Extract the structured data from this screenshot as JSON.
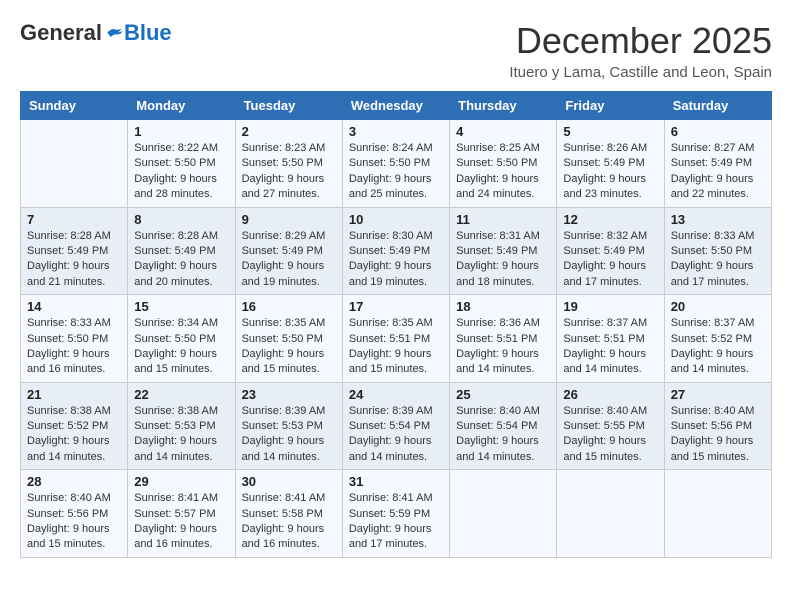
{
  "logo": {
    "general": "General",
    "blue": "Blue"
  },
  "header": {
    "month": "December 2025",
    "location": "Ituero y Lama, Castille and Leon, Spain"
  },
  "columns": [
    "Sunday",
    "Monday",
    "Tuesday",
    "Wednesday",
    "Thursday",
    "Friday",
    "Saturday"
  ],
  "weeks": [
    [
      {
        "day": "",
        "info": ""
      },
      {
        "day": "1",
        "info": "Sunrise: 8:22 AM\nSunset: 5:50 PM\nDaylight: 9 hours and 28 minutes."
      },
      {
        "day": "2",
        "info": "Sunrise: 8:23 AM\nSunset: 5:50 PM\nDaylight: 9 hours and 27 minutes."
      },
      {
        "day": "3",
        "info": "Sunrise: 8:24 AM\nSunset: 5:50 PM\nDaylight: 9 hours and 25 minutes."
      },
      {
        "day": "4",
        "info": "Sunrise: 8:25 AM\nSunset: 5:50 PM\nDaylight: 9 hours and 24 minutes."
      },
      {
        "day": "5",
        "info": "Sunrise: 8:26 AM\nSunset: 5:49 PM\nDaylight: 9 hours and 23 minutes."
      },
      {
        "day": "6",
        "info": "Sunrise: 8:27 AM\nSunset: 5:49 PM\nDaylight: 9 hours and 22 minutes."
      }
    ],
    [
      {
        "day": "7",
        "info": "Sunrise: 8:28 AM\nSunset: 5:49 PM\nDaylight: 9 hours and 21 minutes."
      },
      {
        "day": "8",
        "info": "Sunrise: 8:28 AM\nSunset: 5:49 PM\nDaylight: 9 hours and 20 minutes."
      },
      {
        "day": "9",
        "info": "Sunrise: 8:29 AM\nSunset: 5:49 PM\nDaylight: 9 hours and 19 minutes."
      },
      {
        "day": "10",
        "info": "Sunrise: 8:30 AM\nSunset: 5:49 PM\nDaylight: 9 hours and 19 minutes."
      },
      {
        "day": "11",
        "info": "Sunrise: 8:31 AM\nSunset: 5:49 PM\nDaylight: 9 hours and 18 minutes."
      },
      {
        "day": "12",
        "info": "Sunrise: 8:32 AM\nSunset: 5:49 PM\nDaylight: 9 hours and 17 minutes."
      },
      {
        "day": "13",
        "info": "Sunrise: 8:33 AM\nSunset: 5:50 PM\nDaylight: 9 hours and 17 minutes."
      }
    ],
    [
      {
        "day": "14",
        "info": "Sunrise: 8:33 AM\nSunset: 5:50 PM\nDaylight: 9 hours and 16 minutes."
      },
      {
        "day": "15",
        "info": "Sunrise: 8:34 AM\nSunset: 5:50 PM\nDaylight: 9 hours and 15 minutes."
      },
      {
        "day": "16",
        "info": "Sunrise: 8:35 AM\nSunset: 5:50 PM\nDaylight: 9 hours and 15 minutes."
      },
      {
        "day": "17",
        "info": "Sunrise: 8:35 AM\nSunset: 5:51 PM\nDaylight: 9 hours and 15 minutes."
      },
      {
        "day": "18",
        "info": "Sunrise: 8:36 AM\nSunset: 5:51 PM\nDaylight: 9 hours and 14 minutes."
      },
      {
        "day": "19",
        "info": "Sunrise: 8:37 AM\nSunset: 5:51 PM\nDaylight: 9 hours and 14 minutes."
      },
      {
        "day": "20",
        "info": "Sunrise: 8:37 AM\nSunset: 5:52 PM\nDaylight: 9 hours and 14 minutes."
      }
    ],
    [
      {
        "day": "21",
        "info": "Sunrise: 8:38 AM\nSunset: 5:52 PM\nDaylight: 9 hours and 14 minutes."
      },
      {
        "day": "22",
        "info": "Sunrise: 8:38 AM\nSunset: 5:53 PM\nDaylight: 9 hours and 14 minutes."
      },
      {
        "day": "23",
        "info": "Sunrise: 8:39 AM\nSunset: 5:53 PM\nDaylight: 9 hours and 14 minutes."
      },
      {
        "day": "24",
        "info": "Sunrise: 8:39 AM\nSunset: 5:54 PM\nDaylight: 9 hours and 14 minutes."
      },
      {
        "day": "25",
        "info": "Sunrise: 8:40 AM\nSunset: 5:54 PM\nDaylight: 9 hours and 14 minutes."
      },
      {
        "day": "26",
        "info": "Sunrise: 8:40 AM\nSunset: 5:55 PM\nDaylight: 9 hours and 15 minutes."
      },
      {
        "day": "27",
        "info": "Sunrise: 8:40 AM\nSunset: 5:56 PM\nDaylight: 9 hours and 15 minutes."
      }
    ],
    [
      {
        "day": "28",
        "info": "Sunrise: 8:40 AM\nSunset: 5:56 PM\nDaylight: 9 hours and 15 minutes."
      },
      {
        "day": "29",
        "info": "Sunrise: 8:41 AM\nSunset: 5:57 PM\nDaylight: 9 hours and 16 minutes."
      },
      {
        "day": "30",
        "info": "Sunrise: 8:41 AM\nSunset: 5:58 PM\nDaylight: 9 hours and 16 minutes."
      },
      {
        "day": "31",
        "info": "Sunrise: 8:41 AM\nSunset: 5:59 PM\nDaylight: 9 hours and 17 minutes."
      },
      {
        "day": "",
        "info": ""
      },
      {
        "day": "",
        "info": ""
      },
      {
        "day": "",
        "info": ""
      }
    ]
  ]
}
